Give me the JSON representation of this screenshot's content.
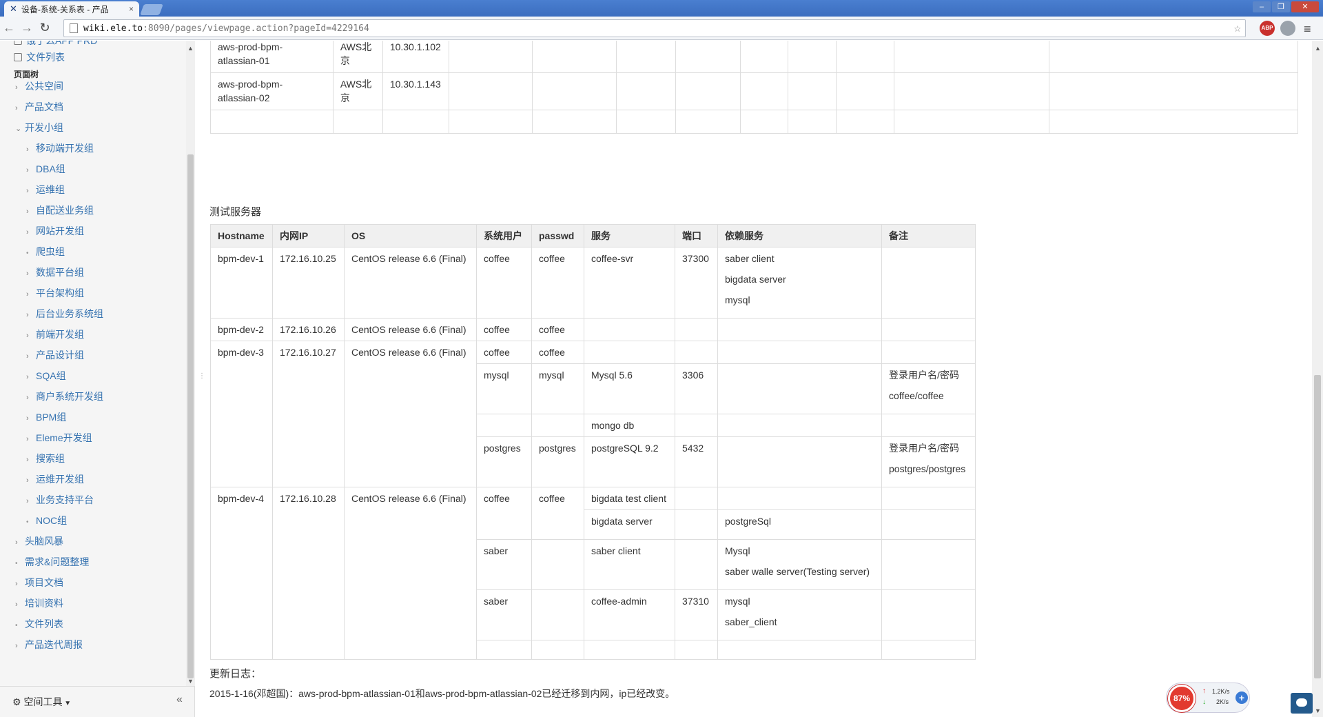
{
  "browser": {
    "tab_title": "设备-系统-关系表 - 产品",
    "tab_close": "×",
    "url_host": "wiki.ele.to",
    "url_path": ":8090/pages/viewpage.action?pageId=4229164",
    "abp_label": "ABP"
  },
  "sidebar": {
    "top_items": [
      "饿了么APP PRD",
      "文件列表"
    ],
    "heading": "页面树",
    "tree": [
      {
        "label": "公共空间",
        "level": 0,
        "marker": "chevron"
      },
      {
        "label": "产品文档",
        "level": 0,
        "marker": "chevron"
      },
      {
        "label": "开发小组",
        "level": 0,
        "marker": "open"
      },
      {
        "label": "移动端开发组",
        "level": 1,
        "marker": "chevron"
      },
      {
        "label": "DBA组",
        "level": 1,
        "marker": "chevron"
      },
      {
        "label": "运维组",
        "level": 1,
        "marker": "chevron"
      },
      {
        "label": "自配送业务组",
        "level": 1,
        "marker": "chevron"
      },
      {
        "label": "网站开发组",
        "level": 1,
        "marker": "chevron"
      },
      {
        "label": "爬虫组",
        "level": 1,
        "marker": "bullet"
      },
      {
        "label": "数据平台组",
        "level": 1,
        "marker": "chevron"
      },
      {
        "label": "平台架构组",
        "level": 1,
        "marker": "chevron"
      },
      {
        "label": "后台业务系统组",
        "level": 1,
        "marker": "chevron"
      },
      {
        "label": "前端开发组",
        "level": 1,
        "marker": "chevron"
      },
      {
        "label": "产品设计组",
        "level": 1,
        "marker": "chevron"
      },
      {
        "label": "SQA组",
        "level": 1,
        "marker": "chevron"
      },
      {
        "label": "商户系统开发组",
        "level": 1,
        "marker": "chevron"
      },
      {
        "label": "BPM组",
        "level": 1,
        "marker": "chevron"
      },
      {
        "label": "Eleme开发组",
        "level": 1,
        "marker": "chevron"
      },
      {
        "label": "搜索组",
        "level": 1,
        "marker": "chevron"
      },
      {
        "label": "运维开发组",
        "level": 1,
        "marker": "chevron"
      },
      {
        "label": "业务支持平台",
        "level": 1,
        "marker": "chevron"
      },
      {
        "label": "NOC组",
        "level": 1,
        "marker": "bullet"
      },
      {
        "label": "头脑风暴",
        "level": 0,
        "marker": "chevron"
      },
      {
        "label": "需求&问题整理",
        "level": 0,
        "marker": "bullet"
      },
      {
        "label": "项目文档",
        "level": 0,
        "marker": "chevron"
      },
      {
        "label": "培训资料",
        "level": 0,
        "marker": "chevron"
      },
      {
        "label": "文件列表",
        "level": 0,
        "marker": "bullet"
      },
      {
        "label": "产品迭代周报",
        "level": 0,
        "marker": "chevron"
      }
    ],
    "space_tools": "空间工具"
  },
  "prod_table": {
    "rows": [
      {
        "host": "aws-prod-bpm-atlassian-01",
        "loc": "AWS北京",
        "ip": "10.30.1.102"
      },
      {
        "host": "aws-prod-bpm-atlassian-02",
        "loc": "AWS北京",
        "ip": "10.30.1.143"
      }
    ]
  },
  "test_servers": {
    "title": "测试服务器",
    "headers": [
      "Hostname",
      "内网IP",
      "OS",
      "系统用户",
      "passwd",
      "服务",
      "端口",
      "依赖服务",
      "备注"
    ],
    "hosts": [
      {
        "hostname": "bpm-dev-1",
        "ip": "172.16.10.25",
        "os": "CentOS release 6.6 (Final)",
        "rows": [
          {
            "user": "coffee",
            "passwd": "coffee",
            "service": "coffee-svr",
            "port": "37300",
            "deps": [
              "saber client",
              "bigdata server",
              "mysql"
            ],
            "note": []
          }
        ]
      },
      {
        "hostname": "bpm-dev-2",
        "ip": "172.16.10.26",
        "os": "CentOS release 6.6 (Final)",
        "rows": [
          {
            "user": "coffee",
            "passwd": "coffee",
            "service": "",
            "port": "",
            "deps": [],
            "note": []
          }
        ]
      },
      {
        "hostname": "bpm-dev-3",
        "ip": "172.16.10.27",
        "os": "CentOS release 6.6 (Final)",
        "rows": [
          {
            "user": "coffee",
            "passwd": "coffee",
            "service": "",
            "port": "",
            "deps": [],
            "note": []
          },
          {
            "user": "mysql",
            "passwd": "mysql",
            "service": "Mysql 5.6",
            "port": "3306",
            "deps": [],
            "note": [
              "登录用户名/密码",
              "coffee/coffee"
            ]
          },
          {
            "user": "",
            "passwd": "",
            "service": "mongo db",
            "port": "",
            "deps": [],
            "note": []
          },
          {
            "user": "postgres",
            "passwd": "postgres",
            "service": "postgreSQL 9.2",
            "port": "5432",
            "deps": [],
            "note": [
              "登录用户名/密码",
              "postgres/postgres"
            ]
          }
        ]
      },
      {
        "hostname": "bpm-dev-4",
        "ip": "172.16.10.28",
        "os": "CentOS release 6.6 (Final)",
        "rows": [
          {
            "user": "coffee",
            "passwd": "coffee",
            "service": "bigdata test client",
            "port": "",
            "deps": [],
            "note": [],
            "merge_user_next": true
          },
          {
            "service": "bigdata server",
            "port": "",
            "deps": [
              "postgreSql"
            ],
            "note": [],
            "merged": true
          },
          {
            "user": "saber",
            "passwd": "",
            "service": "saber client",
            "port": "",
            "deps": [
              "Mysql",
              "saber walle server(Testing server)"
            ],
            "note": []
          },
          {
            "user": "saber",
            "passwd": "",
            "service": "coffee-admin",
            "port": "37310",
            "deps": [
              "mysql",
              "saber_client"
            ],
            "note": []
          },
          {
            "user": "",
            "passwd": "",
            "service": "",
            "port": "",
            "deps": [],
            "note": []
          }
        ]
      }
    ]
  },
  "update_log": {
    "title": "更新日志：",
    "text": "2015-1-16(邓超国)：aws-prod-bpm-atlassian-01和aws-prod-bpm-atlassian-02已经迁移到内网，ip已经改变。"
  },
  "widgets": {
    "cpu_percent": "87%",
    "net_up": "1.2K/s",
    "net_down": "2K/s"
  }
}
